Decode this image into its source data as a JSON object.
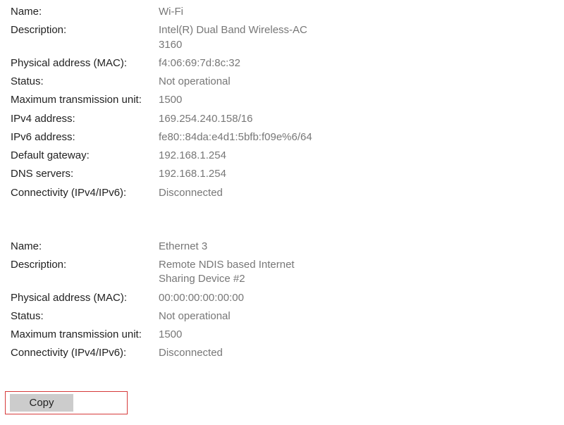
{
  "labels": {
    "name": "Name:",
    "description": "Description:",
    "mac": "Physical address (MAC):",
    "status": "Status:",
    "mtu": "Maximum transmission unit:",
    "ipv4": "IPv4 address:",
    "ipv6": "IPv6 address:",
    "gateway": "Default gateway:",
    "dns": "DNS servers:",
    "conn": "Connectivity (IPv4/IPv6):"
  },
  "adapters": [
    {
      "name": "Wi-Fi",
      "description": "Intel(R) Dual Band Wireless-AC 3160",
      "mac": "f4:06:69:7d:8c:32",
      "status": "Not operational",
      "mtu": "1500",
      "ipv4": "169.254.240.158/16",
      "ipv6": "fe80::84da:e4d1:5bfb:f09e%6/64",
      "gateway": "192.168.1.254",
      "dns": "192.168.1.254",
      "conn": "Disconnected"
    },
    {
      "name": "Ethernet 3",
      "description": "Remote NDIS based Internet Sharing Device #2",
      "mac": "00:00:00:00:00:00",
      "status": "Not operational",
      "mtu": "1500",
      "conn": "Disconnected"
    }
  ],
  "buttons": {
    "copy": "Copy"
  }
}
